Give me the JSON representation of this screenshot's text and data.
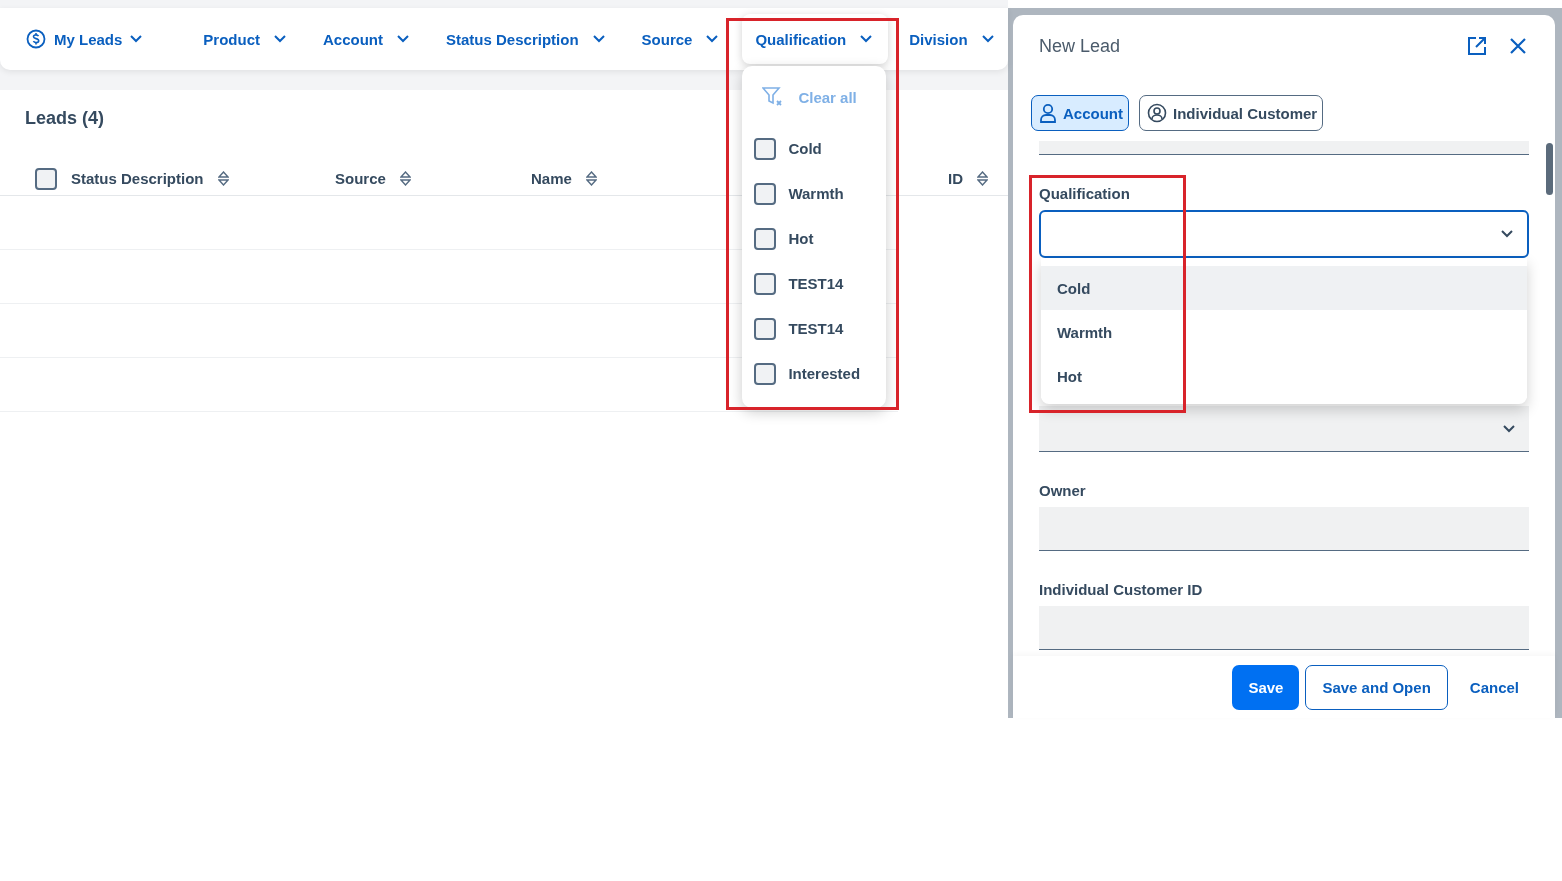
{
  "filter_bar": {
    "filters": [
      {
        "label": "My Leads",
        "kind": "view",
        "open": false
      },
      {
        "label": "Product",
        "kind": "filter",
        "open": false
      },
      {
        "label": "Account",
        "kind": "filter",
        "open": false
      },
      {
        "label": "Status Description",
        "kind": "filter",
        "open": false
      },
      {
        "label": "Source",
        "kind": "filter",
        "open": false
      },
      {
        "label": "Qualification",
        "kind": "filter",
        "open": true
      },
      {
        "label": "Division",
        "kind": "filter",
        "open": false
      }
    ]
  },
  "filter_menu": {
    "clear_label": "Clear all",
    "options": [
      {
        "label": "Cold",
        "checked": false
      },
      {
        "label": "Warmth",
        "checked": false
      },
      {
        "label": "Hot",
        "checked": false
      },
      {
        "label": "TEST14",
        "checked": false
      },
      {
        "label": "TEST14",
        "checked": false
      },
      {
        "label": "Interested",
        "checked": false
      }
    ]
  },
  "list": {
    "title": "Leads (4)",
    "select_all_checked": false,
    "columns": [
      "Status Description",
      "Source",
      "Name",
      "ID"
    ]
  },
  "panel": {
    "title": "New Lead",
    "segments": [
      {
        "label": "Account",
        "kind": "person",
        "selected": true
      },
      {
        "label": "Individual Customer",
        "kind": "customer",
        "selected": false
      }
    ],
    "fields": [
      {
        "label": "Qualification",
        "kind": "select",
        "focused": true,
        "options": [
          {
            "label": "Cold",
            "highlighted": true
          },
          {
            "label": "Warmth",
            "highlighted": false
          },
          {
            "label": "Hot",
            "highlighted": false
          }
        ]
      },
      {
        "kind": "select",
        "focused": false
      },
      {
        "label": "Owner",
        "kind": "text",
        "focused": false
      },
      {
        "label": "Individual Customer ID",
        "kind": "text",
        "focused": false
      }
    ],
    "buttons": [
      {
        "label": "Save",
        "kind": "primary"
      },
      {
        "label": "Save and Open",
        "kind": "secondary"
      },
      {
        "label": "Cancel",
        "kind": "link"
      }
    ]
  }
}
